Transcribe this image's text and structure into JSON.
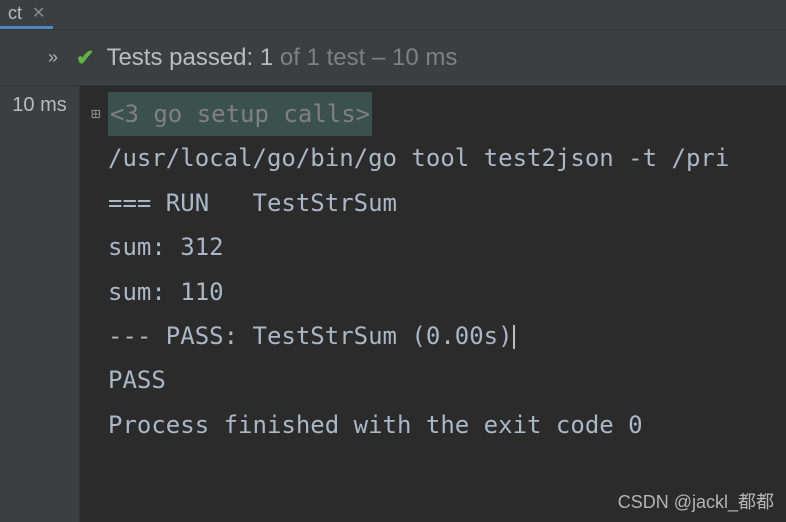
{
  "tab": {
    "label_suffix": "ct"
  },
  "status": {
    "prefix": "Tests passed: ",
    "passed_count": "1",
    "suffix": " of 1 test – 10 ms"
  },
  "sidebar": {
    "time": "10 ms"
  },
  "console": {
    "folded": "<3 go setup calls>",
    "lines": [
      "/usr/local/go/bin/go tool test2json -t /pri",
      "=== RUN   TestStrSum",
      "sum: 312",
      "sum: 110",
      "--- PASS: TestStrSum (0.00s)",
      "PASS",
      "",
      "Process finished with the exit code 0"
    ]
  },
  "watermark": "CSDN @jackl_都都"
}
